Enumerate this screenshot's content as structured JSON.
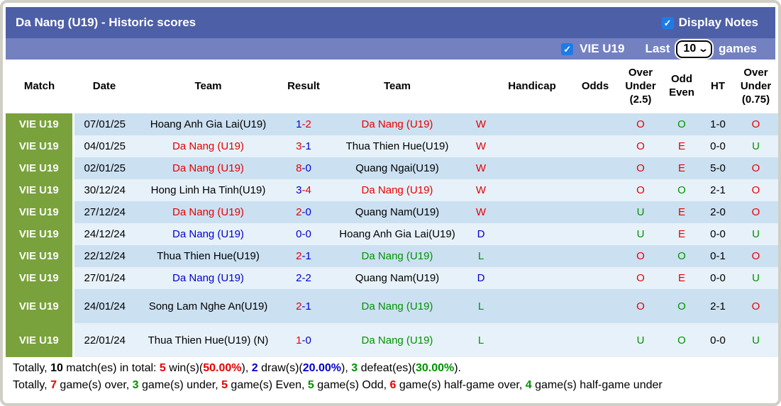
{
  "header": {
    "title": "Da Nang (U19) - Historic scores",
    "display_notes_label": "Display Notes",
    "display_notes_checked": true
  },
  "filterbar": {
    "league_checked": true,
    "league_label": "VIE U19",
    "last_label": "Last",
    "games_count": "10",
    "games_label": "games"
  },
  "colors": {
    "titlebar": "#4d5fa6",
    "filterbar": "#7381c0",
    "badge_green": "#7aa23c",
    "row_dark": "#cbe0f1",
    "row_light": "#e7f1f9",
    "win_red": "#e60000",
    "draw_blue": "#0000d0",
    "loss_green": "#009300",
    "checkbox_blue": "#1e7be6"
  },
  "table": {
    "columns": [
      {
        "key": "match",
        "label": "Match"
      },
      {
        "key": "date",
        "label": "Date"
      },
      {
        "key": "team1",
        "label": "Team"
      },
      {
        "key": "result",
        "label": "Result"
      },
      {
        "key": "team2",
        "label": "Team"
      },
      {
        "key": "wdl",
        "label": ""
      },
      {
        "key": "handicap",
        "label": "Handicap"
      },
      {
        "key": "odds",
        "label": "Odds"
      },
      {
        "key": "ou25",
        "label": "Over Under (2.5)"
      },
      {
        "key": "oddeven",
        "label": "Odd Even"
      },
      {
        "key": "ht",
        "label": "HT"
      },
      {
        "key": "ou075",
        "label": "Over Under (0.75)"
      }
    ],
    "rows": [
      {
        "badge": "VIE U19",
        "date": "07/01/25",
        "team1": {
          "t": "Hoang Anh Gia Lai(U19)",
          "c": "black"
        },
        "score": {
          "h": "1",
          "hc": "blue",
          "a": "2",
          "ac": "red"
        },
        "team2": {
          "t": "Da Nang (U19)",
          "c": "red"
        },
        "wdl": {
          "t": "W",
          "c": "red"
        },
        "handicap": "",
        "odds": "",
        "ou25": {
          "t": "O",
          "c": "red"
        },
        "oddeven": {
          "t": "O",
          "c": "green"
        },
        "ht": "1-0",
        "ou075": {
          "t": "O",
          "c": "red"
        }
      },
      {
        "badge": "VIE U19",
        "date": "04/01/25",
        "team1": {
          "t": "Da Nang (U19)",
          "c": "red"
        },
        "score": {
          "h": "3",
          "hc": "red",
          "a": "1",
          "ac": "blue"
        },
        "team2": {
          "t": "Thua Thien Hue(U19)",
          "c": "black"
        },
        "wdl": {
          "t": "W",
          "c": "red"
        },
        "handicap": "",
        "odds": "",
        "ou25": {
          "t": "O",
          "c": "red"
        },
        "oddeven": {
          "t": "E",
          "c": "red"
        },
        "ht": "0-0",
        "ou075": {
          "t": "U",
          "c": "green"
        }
      },
      {
        "badge": "VIE U19",
        "date": "02/01/25",
        "team1": {
          "t": "Da Nang (U19)",
          "c": "red"
        },
        "score": {
          "h": "8",
          "hc": "red",
          "a": "0",
          "ac": "blue"
        },
        "team2": {
          "t": "Quang Ngai(U19)",
          "c": "black"
        },
        "wdl": {
          "t": "W",
          "c": "red"
        },
        "handicap": "",
        "odds": "",
        "ou25": {
          "t": "O",
          "c": "red"
        },
        "oddeven": {
          "t": "E",
          "c": "red"
        },
        "ht": "5-0",
        "ou075": {
          "t": "O",
          "c": "red"
        }
      },
      {
        "badge": "VIE U19",
        "date": "30/12/24",
        "team1": {
          "t": "Hong Linh Ha Tinh(U19)",
          "c": "black"
        },
        "score": {
          "h": "3",
          "hc": "blue",
          "a": "4",
          "ac": "red"
        },
        "team2": {
          "t": "Da Nang (U19)",
          "c": "red"
        },
        "wdl": {
          "t": "W",
          "c": "red"
        },
        "handicap": "",
        "odds": "",
        "ou25": {
          "t": "O",
          "c": "red"
        },
        "oddeven": {
          "t": "O",
          "c": "green"
        },
        "ht": "2-1",
        "ou075": {
          "t": "O",
          "c": "red"
        }
      },
      {
        "badge": "VIE U19",
        "date": "27/12/24",
        "team1": {
          "t": "Da Nang (U19)",
          "c": "red"
        },
        "score": {
          "h": "2",
          "hc": "red",
          "a": "0",
          "ac": "blue"
        },
        "team2": {
          "t": "Quang Nam(U19)",
          "c": "black"
        },
        "wdl": {
          "t": "W",
          "c": "red"
        },
        "handicap": "",
        "odds": "",
        "ou25": {
          "t": "U",
          "c": "green"
        },
        "oddeven": {
          "t": "E",
          "c": "red"
        },
        "ht": "2-0",
        "ou075": {
          "t": "O",
          "c": "red"
        }
      },
      {
        "badge": "VIE U19",
        "date": "24/12/24",
        "team1": {
          "t": "Da Nang (U19)",
          "c": "blue"
        },
        "score": {
          "h": "0",
          "hc": "blue",
          "a": "0",
          "ac": "blue"
        },
        "team2": {
          "t": "Hoang Anh Gia Lai(U19)",
          "c": "black"
        },
        "wdl": {
          "t": "D",
          "c": "blue"
        },
        "handicap": "",
        "odds": "",
        "ou25": {
          "t": "U",
          "c": "green"
        },
        "oddeven": {
          "t": "E",
          "c": "red"
        },
        "ht": "0-0",
        "ou075": {
          "t": "U",
          "c": "green"
        }
      },
      {
        "badge": "VIE U19",
        "date": "22/12/24",
        "team1": {
          "t": "Thua Thien Hue(U19)",
          "c": "black"
        },
        "score": {
          "h": "2",
          "hc": "red",
          "a": "1",
          "ac": "blue"
        },
        "team2": {
          "t": "Da Nang (U19)",
          "c": "green"
        },
        "wdl": {
          "t": "L",
          "c": "green"
        },
        "handicap": "",
        "odds": "",
        "ou25": {
          "t": "O",
          "c": "red"
        },
        "oddeven": {
          "t": "O",
          "c": "green"
        },
        "ht": "0-1",
        "ou075": {
          "t": "O",
          "c": "red"
        }
      },
      {
        "badge": "VIE U19",
        "date": "27/01/24",
        "team1": {
          "t": "Da Nang (U19)",
          "c": "blue"
        },
        "score": {
          "h": "2",
          "hc": "blue",
          "a": "2",
          "ac": "blue"
        },
        "team2": {
          "t": "Quang Nam(U19)",
          "c": "black"
        },
        "wdl": {
          "t": "D",
          "c": "blue"
        },
        "handicap": "",
        "odds": "",
        "ou25": {
          "t": "O",
          "c": "red"
        },
        "oddeven": {
          "t": "E",
          "c": "red"
        },
        "ht": "0-0",
        "ou075": {
          "t": "U",
          "c": "green"
        }
      },
      {
        "badge": "VIE U19",
        "date": "24/01/24",
        "team1": {
          "t": "Song Lam Nghe An(U19)",
          "c": "black"
        },
        "score": {
          "h": "2",
          "hc": "red",
          "a": "1",
          "ac": "blue"
        },
        "team2": {
          "t": "Da Nang (U19)",
          "c": "green"
        },
        "wdl": {
          "t": "L",
          "c": "green"
        },
        "handicap": "",
        "odds": "",
        "ou25": {
          "t": "O",
          "c": "red"
        },
        "oddeven": {
          "t": "O",
          "c": "green"
        },
        "ht": "2-1",
        "ou075": {
          "t": "O",
          "c": "red"
        },
        "tall": true
      },
      {
        "badge": "VIE U19",
        "date": "22/01/24",
        "team1": {
          "t": "Thua Thien Hue(U19) (N)",
          "c": "black"
        },
        "score": {
          "h": "1",
          "hc": "red",
          "a": "0",
          "ac": "blue"
        },
        "team2": {
          "t": "Da Nang (U19)",
          "c": "green"
        },
        "wdl": {
          "t": "L",
          "c": "green"
        },
        "handicap": "",
        "odds": "",
        "ou25": {
          "t": "U",
          "c": "green"
        },
        "oddeven": {
          "t": "O",
          "c": "green"
        },
        "ht": "0-0",
        "ou075": {
          "t": "U",
          "c": "green"
        },
        "tall": true
      }
    ]
  },
  "footer": {
    "line1": [
      {
        "t": "Totally, ",
        "c": "black",
        "b": false
      },
      {
        "t": "10",
        "c": "black",
        "b": true
      },
      {
        "t": " match(es) in total: ",
        "c": "black",
        "b": false
      },
      {
        "t": "5",
        "c": "red",
        "b": true
      },
      {
        "t": " win(s)(",
        "c": "black",
        "b": false
      },
      {
        "t": "50.00%",
        "c": "red",
        "b": true
      },
      {
        "t": "), ",
        "c": "black",
        "b": false
      },
      {
        "t": "2",
        "c": "blue",
        "b": true
      },
      {
        "t": " draw(s)(",
        "c": "black",
        "b": false
      },
      {
        "t": "20.00%",
        "c": "blue",
        "b": true
      },
      {
        "t": "), ",
        "c": "black",
        "b": false
      },
      {
        "t": "3",
        "c": "green",
        "b": true
      },
      {
        "t": " defeat(es)(",
        "c": "black",
        "b": false
      },
      {
        "t": "30.00%",
        "c": "green",
        "b": true
      },
      {
        "t": ").",
        "c": "black",
        "b": false
      }
    ],
    "line2": [
      {
        "t": "Totally, ",
        "c": "black",
        "b": false
      },
      {
        "t": "7",
        "c": "red",
        "b": true
      },
      {
        "t": " game(s) over, ",
        "c": "black",
        "b": false
      },
      {
        "t": "3",
        "c": "green",
        "b": true
      },
      {
        "t": " game(s) under, ",
        "c": "black",
        "b": false
      },
      {
        "t": "5",
        "c": "red",
        "b": true
      },
      {
        "t": " game(s) Even, ",
        "c": "black",
        "b": false
      },
      {
        "t": "5",
        "c": "green",
        "b": true
      },
      {
        "t": " game(s) Odd, ",
        "c": "black",
        "b": false
      },
      {
        "t": "6",
        "c": "red",
        "b": true
      },
      {
        "t": " game(s) half-game over, ",
        "c": "black",
        "b": false
      },
      {
        "t": "4",
        "c": "green",
        "b": true
      },
      {
        "t": " game(s) half-game under",
        "c": "black",
        "b": false
      }
    ]
  }
}
